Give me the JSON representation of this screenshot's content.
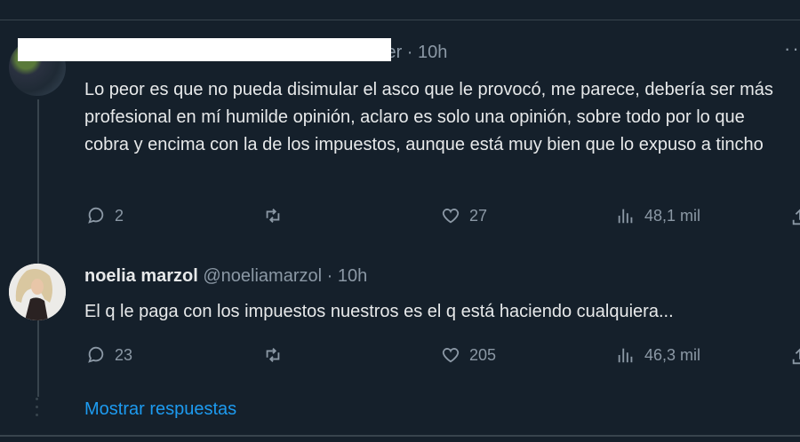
{
  "colors": {
    "background": "#15202b",
    "text": "#e7e9ea",
    "muted": "#8b98a5",
    "link": "#1d9bf0",
    "border": "#38444d"
  },
  "tweets": [
    {
      "header_visible": "ler · 10h",
      "text": "Lo peor es que no pueda disimular el asco que le provocó, me parece, debería ser más profesional en mí humilde opinión, aclaro es solo una opinión, sobre todo por lo que cobra y encima con la de los impuestos, aunque está muy bien que lo expuso a tincho",
      "more_icon": "···",
      "replies": "2",
      "retweets": "",
      "likes": "27",
      "views": "48,1 mil"
    },
    {
      "name": "noelia marzol",
      "handle": "@noeliamarzol",
      "time": "· 10h",
      "text": "El q le paga con los impuestos nuestros es el q está haciendo cualquiera...",
      "replies": "23",
      "retweets": "",
      "likes": "205",
      "views": "46,3 mil"
    }
  ],
  "show_replies": "Mostrar respuestas",
  "icons": {
    "reply": "reply-icon",
    "retweet": "retweet-icon",
    "like": "heart-icon",
    "views": "views-icon",
    "share": "share-icon"
  }
}
